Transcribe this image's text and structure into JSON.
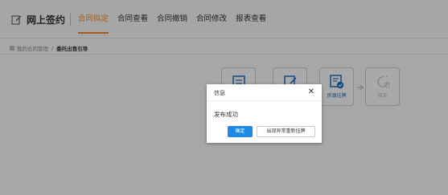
{
  "header": {
    "brand_title": "网上签约",
    "nav": [
      {
        "label": "合同拟定",
        "active": true
      },
      {
        "label": "合同查看",
        "active": false
      },
      {
        "label": "合同撤销",
        "active": false
      },
      {
        "label": "合同修改",
        "active": false
      },
      {
        "label": "报表查看",
        "active": false
      }
    ]
  },
  "breadcrumb": {
    "parent": "我的合同管理",
    "separator": "/",
    "current": "委托出售引导"
  },
  "steps": [
    {
      "label": "",
      "icon": "document-icon",
      "enabled": true
    },
    {
      "label": "",
      "icon": "edit-icon",
      "enabled": true
    },
    {
      "label": "房源挂牌",
      "icon": "listing-check-icon",
      "enabled": true
    },
    {
      "label": "结束",
      "icon": "finish-icon",
      "enabled": false
    }
  ],
  "dialog": {
    "title": "信息",
    "close_glyph": "✕",
    "message": "发布成功",
    "confirm_label": "确定",
    "secondary_label": "出现异常重新挂牌"
  },
  "colors": {
    "accent_orange": "#f08a24",
    "primary_blue": "#1e88e5",
    "overlay": "rgba(0,0,0,0.32)"
  }
}
